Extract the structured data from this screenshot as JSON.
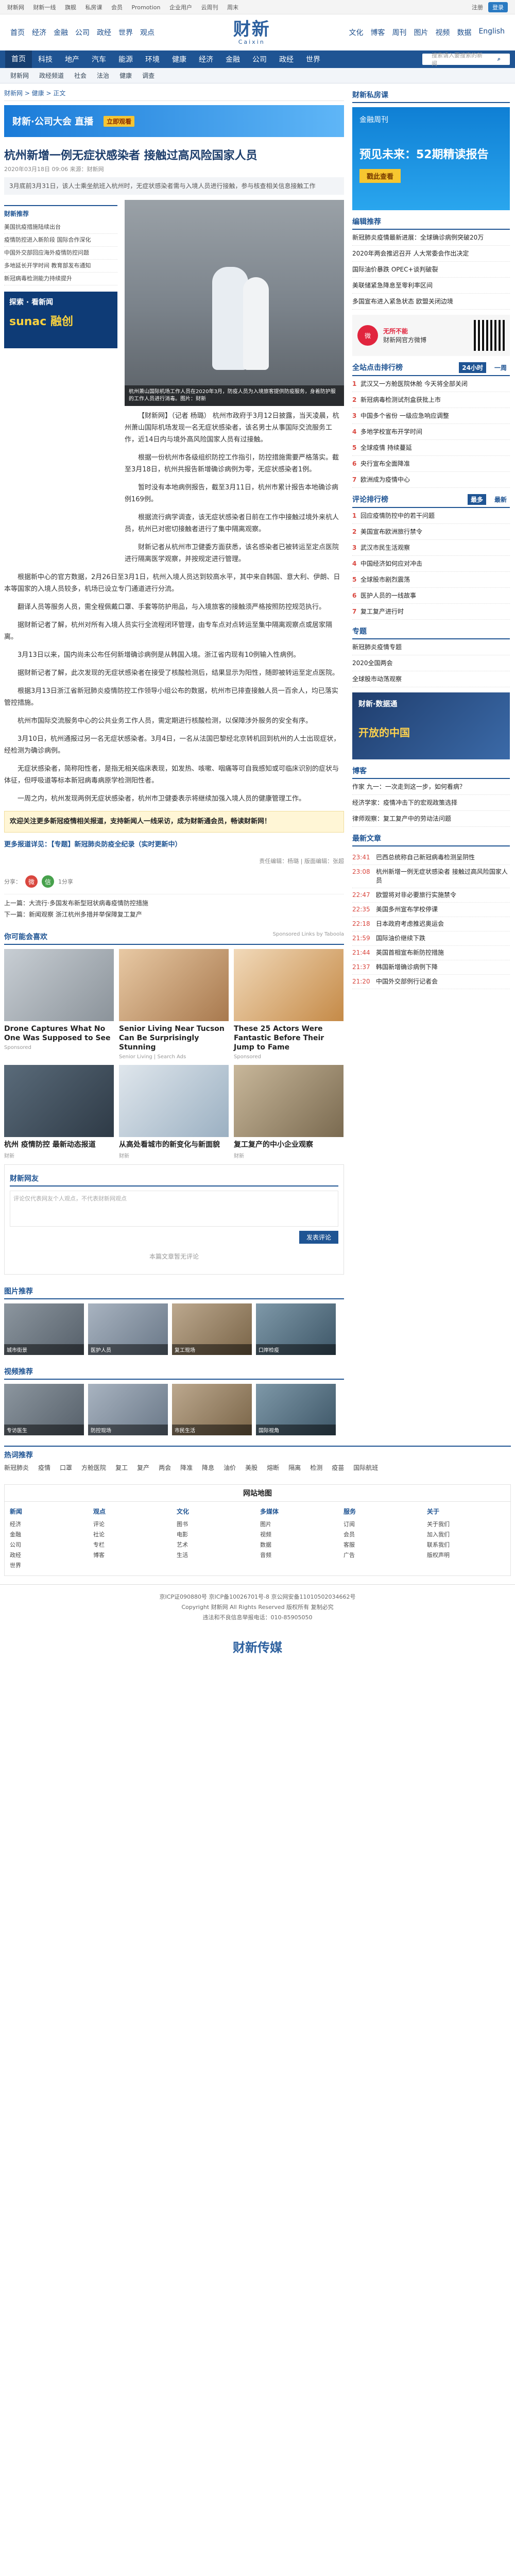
{
  "topbar": {
    "links": [
      "财新网",
      "财新一线",
      "旗舰",
      "私房课",
      "会员",
      "Promotion",
      "企业用户",
      "云周刊",
      "周末"
    ],
    "login": "登录",
    "register": "注册"
  },
  "logo": {
    "cn": "财新",
    "en": "Caixin"
  },
  "left_nav": [
    "首页",
    "经济",
    "金融",
    "公司",
    "政经",
    "世界",
    "观点"
  ],
  "right_nav": [
    "文化",
    "博客",
    "周刊",
    "图片",
    "视频",
    "数据",
    "English"
  ],
  "mainnav": {
    "items": [
      "首页",
      "科技",
      "地产",
      "汽车",
      "能源",
      "环境",
      "健康",
      "经济",
      "金融",
      "公司",
      "政经",
      "世界"
    ],
    "search_placeholder": "搜索请入要搜索的新闻"
  },
  "subnav": [
    "财新网",
    "政经频道",
    "社会",
    "法治",
    "健康",
    "调查"
  ],
  "crumb": "财新网 > 健康 > 正文",
  "banner_ad": {
    "text": "财新·公司大会 直播",
    "tag": "立即观看"
  },
  "article": {
    "title": "杭州新增一例无症状感染者 接触过高风险国家人员",
    "meta": "2020年03月18日 09:06   来源：财新网",
    "summary": "3月底前3月31日，该人士乘坐航班入杭州时，无症状感染者需与入境人员进行接触，参与核查相关信息接触工作",
    "hero_caption": "杭州萧山国际机场工作人员在2020年3月，防疫人员为入境旅客提供防疫服务，身着防护服的工作人员进行消毒。图片：财新",
    "paragraphs": [
      "【财新网】（记者 杨璐） 杭州市政府于3月12日披露，当天凌晨，杭州萧山国际机场发现一名无症状感染者，该名男士从事国际交流服务工作，近14日内与境外高风险国家人员有过接触。",
      "根据一份杭州市各级组织防控工作指引，防控措施需要严格落实。截至3月18日，杭州共报告新增确诊病例为零，无症状感染者1例。",
      "暂时没有本地病例报告，截至3月11日，杭州市累计报告本地确诊病例169例。",
      "根据流行病学调查，该无症状感染者日前在工作中接触过境外来杭人员，杭州已对密切接触者进行了集中隔离观察。",
      "财新记者从杭州市卫健委方面获悉，该名感染者已被转运至定点医院进行隔离医学观察，并按规定进行管理。"
    ],
    "paragraphs_wide": [
      "根据新中心的官方数据，2月26日至3月1日，杭州入境人员达到较高水平，其中来自韩国、意大利、伊朗、日本等国家的入境人员较多，机场已设立专门通道进行分流。",
      "翻译人员等服务人员，需全程佩戴口罩、手套等防护用品，与入境旅客的接触须严格按照防控规范执行。",
      "据财新记者了解，杭州对所有入境人员实行全流程闭环管理，由专车点对点转运至集中隔离观察点或居家隔离。",
      "3月13日以来，国内尚未公布任何新增确诊病例是从韩国入境。浙江省内现有10例输入性病例。",
      "据财新记者了解，此次发现的无症状感染者在接受了核酸检测后，结果显示为阳性，随即被转运至定点医院。",
      "根据3月13日浙江省新冠肺炎疫情防控工作领导小组公布的数据，杭州市已排查接触人员一百余人，均已落实管控措施。",
      "杭州市国际交流服务中心的公共业务工作人员，需定期进行核酸检测，以保障涉外服务的安全有序。",
      "3月10日，杭州通报过另一名无症状感染者。3月4日，一名从法国巴黎经北京转机回到杭州的人士出现症状，经检测为确诊病例。",
      "无症状感染者，简称阳性者，是指无相关临床表现，如发热、咳嗽、咽痛等可自我感知或可临床识别的症状与体征，但呼吸道等标本新冠病毒病原学检测阳性者。",
      "一周之内，杭州发现两例无症状感染者，杭州市卫健委表示将继续加强入境人员的健康管理工作。"
    ],
    "note": "欢迎关注更多新冠疫情相关报道，支持新闻人一线采访，成为财新通会员，畅读财新网！",
    "more": "更多报道详见：【专题】新冠肺炎防疫全纪录（实时更新中）",
    "editor": "责任编辑：杨璐 | 版面编辑：张超"
  },
  "leftcol": {
    "sect_title": "财新推荐",
    "items": [
      "美国抗疫措施陆续出台",
      "疫情防控进入新阶段 国际合作深化",
      "中国外交部回应海外疫情防控问题",
      "多地延长开学时间 教育部发布通知",
      "新冠病毒检测能力持续提升"
    ],
    "promo_top": "探索 · 看新闻",
    "promo_big": "sunac 融创"
  },
  "share": {
    "label": "分享：",
    "b1": "微",
    "b2": "信",
    "count": "1分享"
  },
  "prevnext": [
    "上一篇：大流行·多国发布新型冠状病毒疫情防控措施",
    "下一篇：新闻观察 浙江杭州多措并举保障复工复产"
  ],
  "you_may_like": {
    "title": "你可能会喜欢",
    "sponsor": "Sponsored Links by Taboola",
    "cards": [
      {
        "t": "Drone Captures What No One Was Supposed to See",
        "s": "Sponsored"
      },
      {
        "t": "Senior Living Near Tucson Can Be Surprisingly Stunning",
        "s": "Senior Living | Search Ads"
      },
      {
        "t": "These 25 Actors Were Fantastic Before Their Jump to Fame",
        "s": "Sponsored"
      },
      {
        "t": "杭州 疫情防控 最新动态报道",
        "s": "财新"
      },
      {
        "t": "从高处看城市的新变化与新面貌",
        "s": "财新"
      },
      {
        "t": "复工复产的中小企业观察",
        "s": "财新"
      }
    ]
  },
  "comments": {
    "title": "财新网友",
    "placeholder": "评论仅代表网友个人观点，不代表财新网观点",
    "post": "发表评论",
    "empty": "本篇文章暂无评论"
  },
  "photo_section": {
    "title": "图片推荐",
    "thumbs": [
      "城市街景",
      "医护人员",
      "复工现场",
      "口岸检疫"
    ]
  },
  "video_section": {
    "title": "视频推荐",
    "thumbs": [
      "专访医生",
      "防控现场",
      "市民生活",
      "国际视角"
    ]
  },
  "sidebar": {
    "ad_title": "财新私房课",
    "ad_sub": "金融周刊",
    "ad_big": "预见未来：52期精读报告",
    "ad_cta": "戳此查看",
    "editor_pick_title": "编辑推荐",
    "editor_picks": [
      "新冠肺炎疫情最新进展：全球确诊病例突破20万",
      "2020年两会推迟召开 人大常委会作出决定",
      "国际油价暴跌 OPEC+谈判破裂",
      "美联储紧急降息至零利率区间",
      "多国宣布进入紧急状态 欧盟关闭边境"
    ],
    "weibo": "无所不能",
    "weibo_label": "财新网官方微博",
    "hot_title": "全站点击排行榜",
    "hot_tabs": [
      "24小时",
      "一周"
    ],
    "hot_list": [
      "武汉又一方舱医院休舱 今天将全部关闭",
      "新冠病毒检测试剂盒获批上市",
      "中国多个省份 一级应急响应调整",
      "多地学校宣布开学时间",
      "全球疫情 持续蔓延",
      "央行宣布全面降准",
      "欧洲成为疫情中心"
    ],
    "comment_title": "评论排行榜",
    "comment_tabs": [
      "最多",
      "最新"
    ],
    "comment_list": [
      "回应疫情防控中的若干问题",
      "美国宣布欧洲旅行禁令",
      "武汉市民生活观察",
      "中国经济如何应对冲击",
      "全球股市剧烈震荡",
      "医护人员的一线故事",
      "复工复产进行时"
    ],
    "subject_title": "专题",
    "subjects": [
      "新冠肺炎疫情专题",
      "2020全国两会",
      "全球股市动荡观察"
    ],
    "ad2_top": "财新·数据通",
    "ad2_big": "开放的中国",
    "book_title": "博客",
    "books": [
      "作家 九一：一次走到这一步，如何看病？",
      "经济学家：疫情冲击下的宏观政策选择",
      "律师观察：复工复产中的劳动法问题"
    ],
    "latest_title": "最新文章",
    "latest": [
      {
        "tm": "23:41",
        "t": "巴西总统称自己新冠病毒检测呈阴性"
      },
      {
        "tm": "23:08",
        "t": "杭州新增一例无症状感染者 接触过高风险国家人员"
      },
      {
        "tm": "22:47",
        "t": "欧盟将对非必要旅行实施禁令"
      },
      {
        "tm": "22:35",
        "t": "美国多州宣布学校停课"
      },
      {
        "tm": "22:18",
        "t": "日本政府考虑推迟奥运会"
      },
      {
        "tm": "21:59",
        "t": "国际油价继续下跌"
      },
      {
        "tm": "21:44",
        "t": "英国首相宣布新防控措施"
      },
      {
        "tm": "21:37",
        "t": "韩国新增确诊病例下降"
      },
      {
        "tm": "21:20",
        "t": "中国外交部例行记者会"
      }
    ]
  },
  "hotwords": {
    "title": "热词推荐",
    "words": [
      "新冠肺炎",
      "疫情",
      "口罩",
      "方舱医院",
      "复工",
      "复产",
      "两会",
      "降准",
      "降息",
      "油价",
      "美股",
      "熔断",
      "隔离",
      "检测",
      "疫苗",
      "国际航班"
    ]
  },
  "sitemap": {
    "title": "网站地图",
    "cols": [
      {
        "h": "新闻",
        "items": [
          "经济",
          "金融",
          "公司",
          "政经",
          "世界"
        ]
      },
      {
        "h": "观点",
        "items": [
          "评论",
          "社论",
          "专栏",
          "博客"
        ]
      },
      {
        "h": "文化",
        "items": [
          "图书",
          "电影",
          "艺术",
          "生活"
        ]
      },
      {
        "h": "多媒体",
        "items": [
          "图片",
          "视频",
          "数据",
          "音频"
        ]
      },
      {
        "h": "服务",
        "items": [
          "订阅",
          "会员",
          "客服",
          "广告"
        ]
      },
      {
        "h": "关于",
        "items": [
          "关于我们",
          "加入我们",
          "联系我们",
          "版权声明"
        ]
      }
    ]
  },
  "copyright": [
    "京ICP证090880号  京ICP备10026701号-8  京公网安备11010502034662号",
    "Copyright 财新网 All Rights Reserved 版权所有 复制必究",
    "违法和不良信息举报电话：010-85905050"
  ],
  "footer_logo": "财新传媒"
}
